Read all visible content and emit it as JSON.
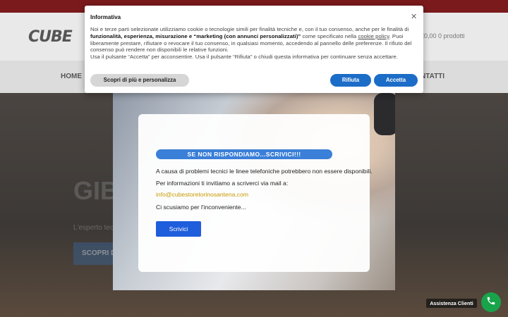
{
  "site": {
    "logo": "CUBE",
    "cart": "€0,00  0 prodotti",
    "nav_home": "HOME",
    "nav_contatti": "NTATTI",
    "hero_title": "GIB",
    "hero_subtitle": "L'esperto tecn",
    "hero_button": "SCOPRI DI"
  },
  "cookie": {
    "title": "Informativa",
    "close_icon": "close-icon",
    "text_1": "Noi e terze parti selezionate utilizziamo cookie o tecnologie simili per finalità tecniche e, con il tuo consenso, anche per le finalità di ",
    "text_bold": "funzionalità, esperienza, misurazione e “marketing (con annunci personalizzati)”",
    "text_2": " come specificato nella ",
    "link": "cookie policy",
    "text_3": ". Puoi liberamente prestare, rifiutare o revocare il tuo consenso, in qualsiasi momento, accedendo al pannello delle preferenze. Il rifiuto del consenso può rendere non disponibili le relative funzioni.",
    "text_4": "Usa il pulsante “Accetta” per acconsentire. Usa il pulsante “Rifiuta” o chiudi questa informativa per continuare senza accettare.",
    "btn_personalize": "Scopri di più e personalizza",
    "btn_reject": "Rifiuta",
    "btn_accept": "Accetta"
  },
  "popup": {
    "heading": "SE NON RISPONDIAMO...SCRIVICI!!!",
    "line1": "A causa di problemi tecnici le linee telefoniche potrebbero non essere disponibili.",
    "line2": "Per informazioni ti invitiamo a scriverci via mail a:",
    "email": "info@cubestoretorinosantena.com",
    "line3": "Ci scusiamo per l'inconveniente...",
    "button": "Scrivici"
  },
  "support": {
    "label": "Assistenza Clienti",
    "icon": "phone-icon",
    "color": "#19a34a"
  }
}
